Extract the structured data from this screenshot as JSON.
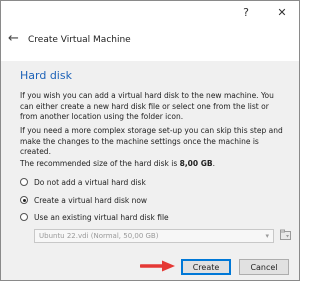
{
  "titlebar": {
    "help_icon": "?",
    "close_icon": "✕"
  },
  "header": {
    "back_icon": "←",
    "title": "Create Virtual Machine"
  },
  "section": {
    "title": "Hard disk"
  },
  "paragraphs": [
    "If you wish you can add a virtual hard disk to the new machine. You can either create a new hard disk file or select one from the list or from another location using the folder icon.",
    "If you need a more complex storage set-up you can skip this step and make the changes to the machine settings once the machine is created."
  ],
  "recommended": {
    "prefix": "The recommended size of the hard disk is ",
    "size": "8,00 GB",
    "suffix": "."
  },
  "options": [
    {
      "label": "Do not add a virtual hard disk",
      "selected": false
    },
    {
      "label": "Create a virtual hard disk now",
      "selected": true
    },
    {
      "label": "Use an existing virtual hard disk file",
      "selected": false
    }
  ],
  "disk_select": {
    "value": "Ubuntu 22.vdi (Normal, 50,00 GB)"
  },
  "buttons": {
    "create": "Create",
    "cancel": "Cancel"
  },
  "colors": {
    "heading": "#1e63b8",
    "arrow": "#e53935",
    "focus": "#0078d7"
  }
}
